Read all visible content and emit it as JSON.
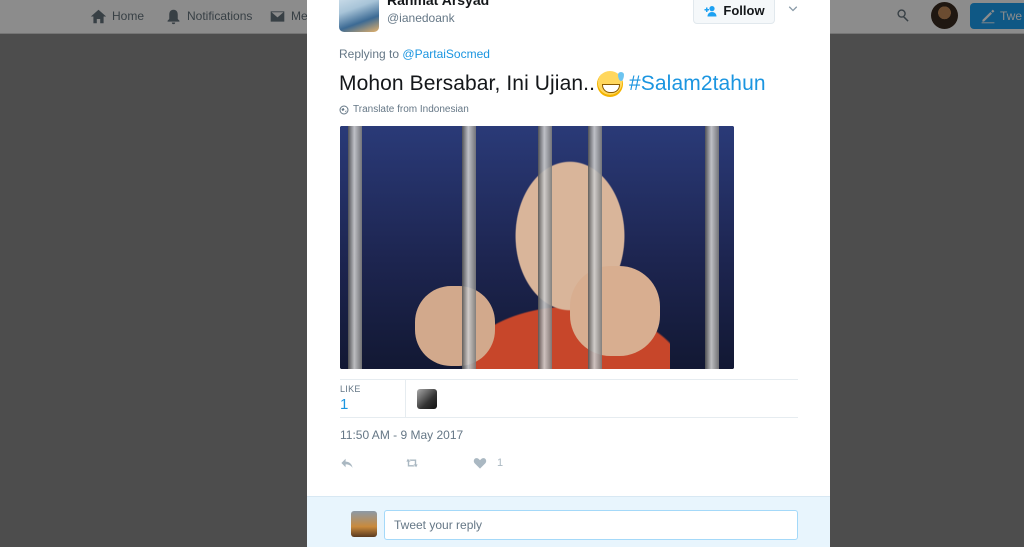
{
  "nav": {
    "home_label": "Home",
    "notifications_label": "Notifications",
    "messages_label": "Me",
    "tweet_button_label": "Twe"
  },
  "tweet": {
    "author_name": "Rahmat Arsyad",
    "author_handle": "@ianedoank",
    "follow_label": "Follow",
    "replying_prefix": "Replying to",
    "replying_mention": "@PartaiSocmed",
    "text": "Mohon Bersabar, Ini Ujian..",
    "emoji": "sweat-smile-emoji",
    "hashtag": "#Salam2tahun",
    "translate_label": "Translate from Indonesian",
    "like_label": "LIKE",
    "like_count": "1",
    "timestamp": "11:50 AM - 9 May 2017",
    "action_like_count": "1"
  },
  "reply": {
    "placeholder": "Tweet your reply"
  },
  "icons": {
    "home": "home-icon",
    "notifications": "bell-icon",
    "messages": "envelope-icon",
    "search": "search-icon",
    "follow": "add-user-icon",
    "caret": "chevron-down-icon",
    "translate": "globe-icon",
    "reply": "reply-icon",
    "retweet": "retweet-icon",
    "like": "heart-icon",
    "compose": "compose-icon"
  },
  "colors": {
    "accent": "#1da1f2",
    "link": "#1b95e0",
    "text": "#14171a",
    "muted": "#657786"
  }
}
